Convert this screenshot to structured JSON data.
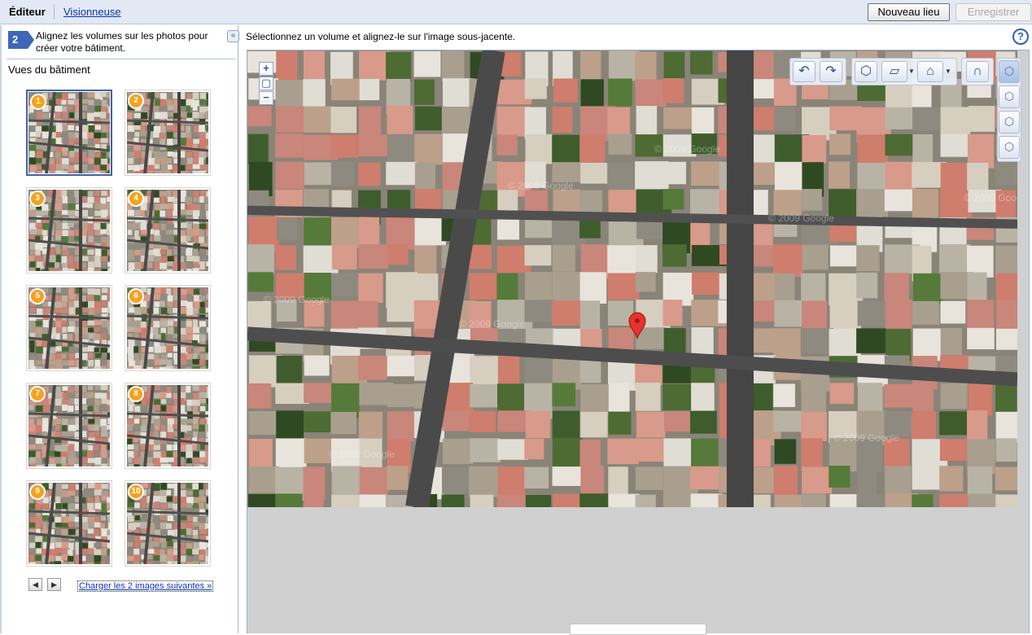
{
  "topbar": {
    "tab_editor": "Éditeur",
    "tab_viewer": "Visionneuse",
    "btn_new_place": "Nouveau lieu",
    "btn_save": "Enregistrer"
  },
  "left_panel": {
    "step_number": "2",
    "step_text": "Alignez les volumes sur les photos pour créer votre bâtiment.",
    "collapse_label": "«",
    "views_title": "Vues du bâtiment",
    "thumbnails": [
      {
        "number": "1",
        "selected": true
      },
      {
        "number": "2",
        "selected": false
      },
      {
        "number": "3",
        "selected": false
      },
      {
        "number": "4",
        "selected": false
      },
      {
        "number": "5",
        "selected": false
      },
      {
        "number": "6",
        "selected": false
      },
      {
        "number": "7",
        "selected": false
      },
      {
        "number": "8",
        "selected": false
      },
      {
        "number": "9",
        "selected": false
      },
      {
        "number": "10",
        "selected": false
      }
    ],
    "prev_label": "◀",
    "next_label": "▶",
    "load_more": "Charger les 2 images suivantes »"
  },
  "main": {
    "instruction": "Sélectionnez un volume et alignez-le sur l'image sous-jacente.",
    "help_label": "?",
    "zoom": {
      "in": "+",
      "reset": "▢",
      "out": "−"
    },
    "watermark": "© 2009 Google",
    "tool_icons": [
      "undo-icon",
      "redo-icon",
      "box-icon",
      "plane-icon",
      "roof-icon",
      "magnet-icon"
    ],
    "view_icons": [
      "view-box-1-icon",
      "view-box-2-icon",
      "view-box-3-icon",
      "view-box-4-icon"
    ]
  },
  "colors": {
    "accent": "#3d67b8",
    "badge_orange": "#f5a21e",
    "link": "#0b33b8",
    "topbar_bg": "#e2e9f5"
  }
}
